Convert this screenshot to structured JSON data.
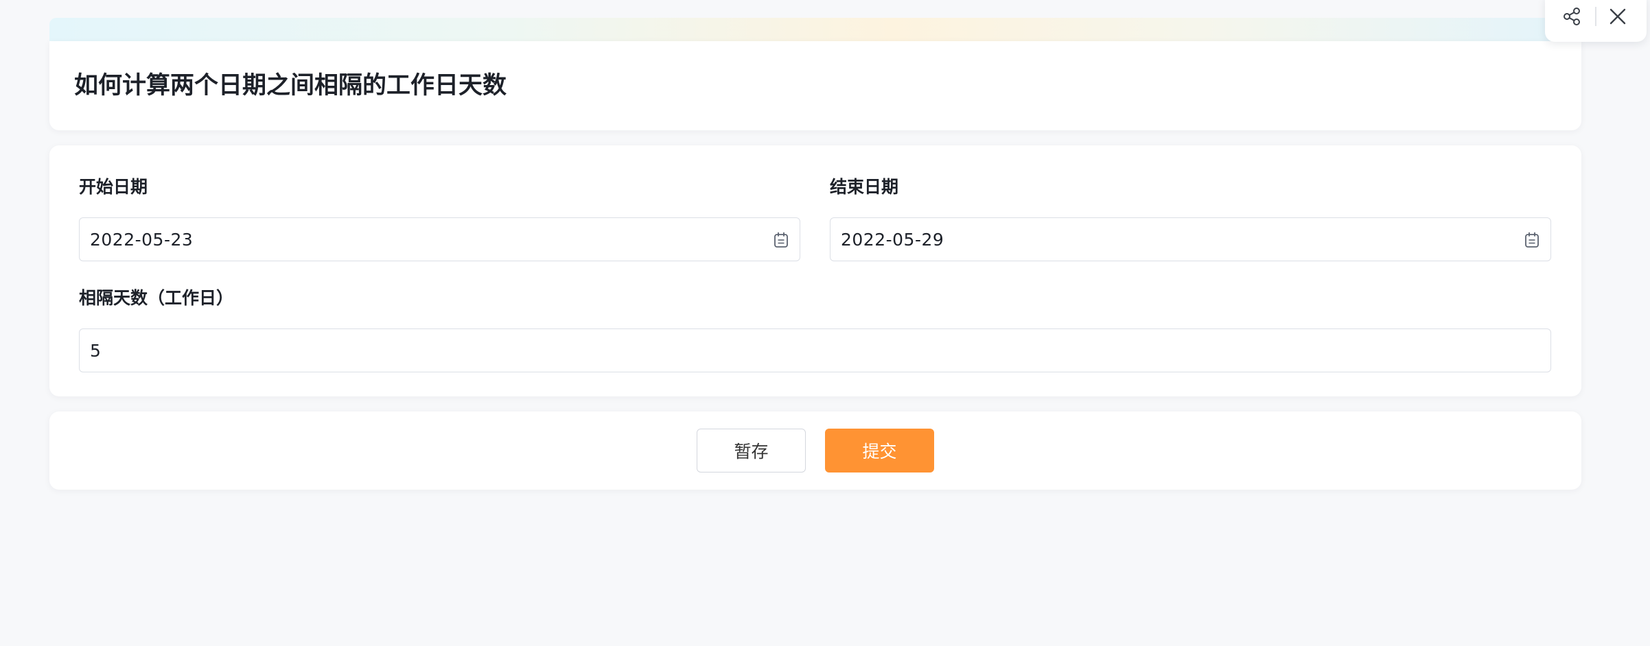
{
  "page": {
    "title": "如何计算两个日期之间相隔的工作日天数"
  },
  "form": {
    "start_date": {
      "label": "开始日期",
      "value": "2022-05-23",
      "icon": "calendar-icon"
    },
    "end_date": {
      "label": "结束日期",
      "value": "2022-05-29",
      "icon": "calendar-icon"
    },
    "working_days": {
      "label": "相隔天数（工作日）",
      "value": "5"
    }
  },
  "actions": {
    "save_label": "暂存",
    "submit_label": "提交"
  },
  "toolbar": {
    "share_icon": "share-icon",
    "close_icon": "close-icon"
  },
  "colors": {
    "accent": "#ff9333",
    "background": "#f7f8fa",
    "card": "#ffffff",
    "border": "#dcdfe6"
  }
}
